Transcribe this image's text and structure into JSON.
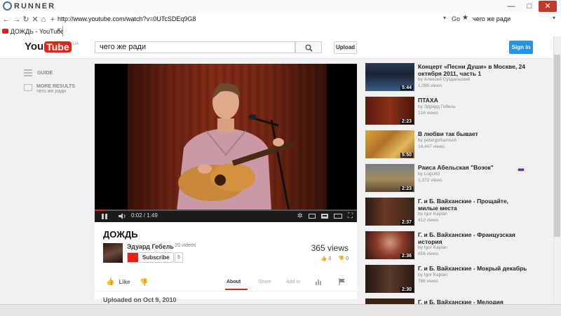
{
  "browser": {
    "brand": "RUNNER",
    "window_buttons": [
      "—",
      "□",
      "✕"
    ],
    "url": "http://www.youtube.com/watch?v=0UTcSDEq9G8",
    "go_label": "Go",
    "search_value": "чего же ради",
    "tab_title": "ДОЖДЬ - YouTube",
    "tab_close": "x"
  },
  "header": {
    "logo_you": "You",
    "logo_tube": "Tube",
    "logo_cc": "UA",
    "search_value": "чего же ради",
    "upload_label": "Upload",
    "signin_label": "Sign in"
  },
  "guide": {
    "guide_label": "GUIDE",
    "more_results_label": "MORE RESULTS",
    "more_results_query": "чего же ради"
  },
  "player": {
    "time": "0:02 / 1:49",
    "progress": 0.02
  },
  "video": {
    "title": "ДОЖДЬ",
    "channel": "Эдуард Гебель",
    "channel_videos": "· 20 videos",
    "subscribe_label": "Subscribe",
    "subscriber_count": "5",
    "views": "365 views",
    "likes": "0",
    "dislikes": "0",
    "like_label": "Like",
    "tabs": [
      "About",
      "Share",
      "Add to"
    ],
    "uploaded": "Uploaded on Oct 9, 2010"
  },
  "related": [
    {
      "title": "Концерт «Песни Души» в Москве, 24 октября 2011, часть 1",
      "by": "by Алексей Суздальский",
      "views": "1,095 views",
      "duration": "5:44"
    },
    {
      "title": "ПТАХА",
      "by": "by Эдуард Гебель",
      "views": "216 views",
      "duration": "2:23"
    },
    {
      "title": "В любви так бывает",
      "by": "by petergofsamson",
      "views": "14,447 views",
      "duration": "5:50"
    },
    {
      "title": "Раиса Абельская \"Возок\"",
      "by": "by LogU62",
      "views": "1,372 views",
      "duration": "2:23"
    },
    {
      "title": "Г. и Б. Вайханские - Прощайте, милые места",
      "by": "by Igor Kaplan",
      "views": "412 views",
      "duration": "2:37"
    },
    {
      "title": "Г. и Б. Вайханские - Французская история",
      "by": "by Igor Kaplan",
      "views": "856 views",
      "duration": "2:36"
    },
    {
      "title": "Г. и Б. Вайханские - Мокрый декабрь",
      "by": "by Igor Kaplan",
      "views": "786 views",
      "duration": "2:30"
    },
    {
      "title": "Г. и Б. Вайханские - Мелодия",
      "by": "",
      "views": "",
      "duration": ""
    }
  ],
  "colors": {
    "accent": "#e62117",
    "signin": "#2793e6"
  }
}
